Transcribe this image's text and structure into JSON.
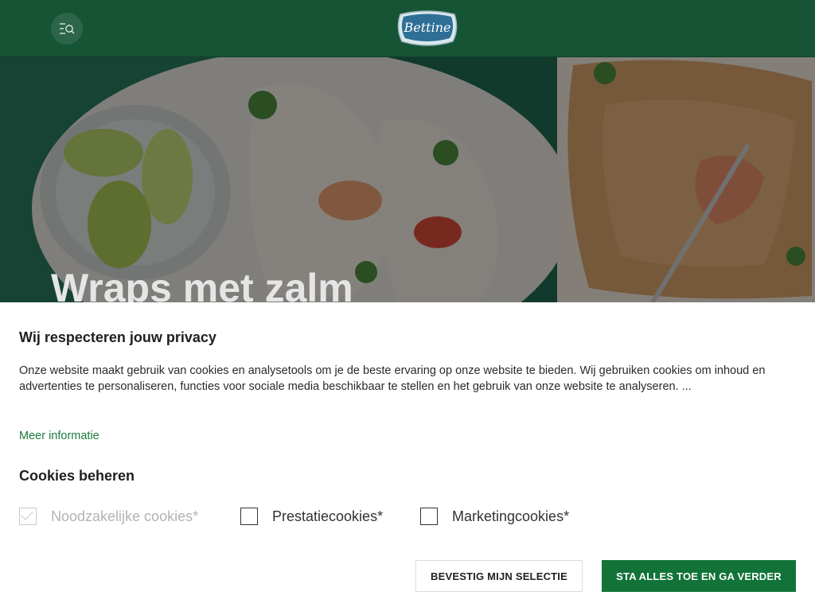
{
  "header": {
    "brand_text": "Bettine",
    "menu_icon": "menu-search-icon"
  },
  "hero": {
    "title": "Wraps met zalm"
  },
  "consent": {
    "title": "Wij respecteren jouw privacy",
    "description": "Onze website maakt gebruik van cookies en analysetools om je de beste ervaring op onze website te bieden. Wij gebruiken cookies om inhoud en advertenties te personaliseren, functies voor sociale media beschikbaar te stellen en het gebruik van onze website te analyseren. ...",
    "more_link": "Meer informatie",
    "manage_title": "Cookies beheren",
    "options": [
      {
        "label": "Noodzakelijke cookies*",
        "checked": true,
        "disabled": true
      },
      {
        "label": "Prestatiecookies*",
        "checked": false,
        "disabled": false
      },
      {
        "label": "Marketingcookies*",
        "checked": false,
        "disabled": false
      }
    ],
    "confirm_button": "BEVESTIG MIJN SELECTIE",
    "accept_all_button": "STA ALLES TOE EN GA VERDER"
  },
  "colors": {
    "header_bg": "#165436",
    "accent_green": "#127339",
    "link_green": "#1b7a3e"
  }
}
